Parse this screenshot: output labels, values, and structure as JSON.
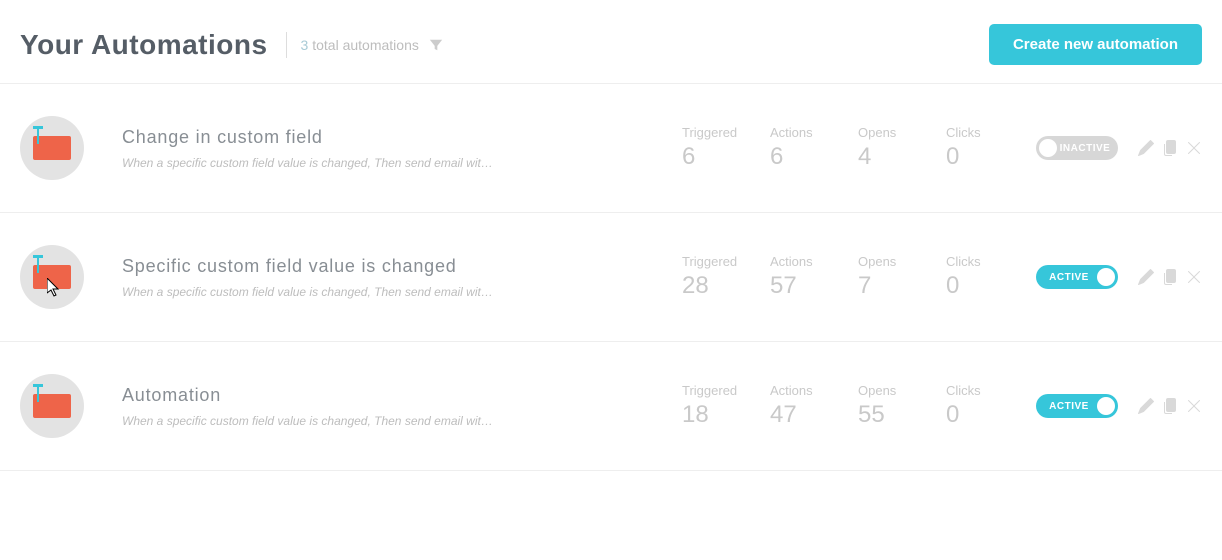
{
  "header": {
    "title": "Your Automations",
    "total_count": "3",
    "total_label": " total automations",
    "create_button": "Create new automation"
  },
  "stat_labels": {
    "triggered": "Triggered",
    "actions": "Actions",
    "opens": "Opens",
    "clicks": "Clicks"
  },
  "toggle_labels": {
    "active": "ACTIVE",
    "inactive": "INACTIVE"
  },
  "automations": [
    {
      "title": "Change in custom field",
      "description": "When a specific custom field value is changed, Then send email wit…",
      "triggered": "6",
      "actions": "6",
      "opens": "4",
      "clicks": "0",
      "status": "inactive"
    },
    {
      "title": "Specific custom field value is changed",
      "description": "When a specific custom field value is changed, Then send email wit…",
      "triggered": "28",
      "actions": "57",
      "opens": "7",
      "clicks": "0",
      "status": "active"
    },
    {
      "title": "Automation",
      "description": "When a specific custom field value is changed, Then send email wit…",
      "triggered": "18",
      "actions": "47",
      "opens": "55",
      "clicks": "0",
      "status": "active"
    }
  ]
}
